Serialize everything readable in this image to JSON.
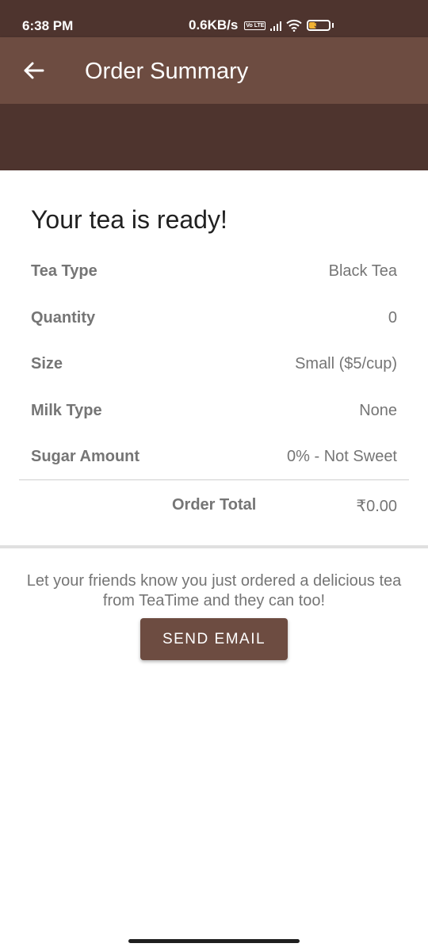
{
  "status_bar": {
    "time": "6:38 PM",
    "network_speed": "0.6KB/s",
    "volte_badge": "Vo LTE",
    "battery_level": "37",
    "battery_percent": 37
  },
  "app_bar": {
    "title": "Order Summary",
    "back_icon": "arrow-left-icon"
  },
  "summary": {
    "heading": "Your tea is ready!",
    "rows": [
      {
        "label": "Tea Type",
        "value": "Black Tea"
      },
      {
        "label": "Quantity",
        "value": "0"
      },
      {
        "label": "Size",
        "value": "Small ($5/cup)"
      },
      {
        "label": "Milk Type",
        "value": "None"
      },
      {
        "label": "Sugar Amount",
        "value": "0% - Not Sweet"
      }
    ],
    "total_label": "Order Total",
    "total_value": "₹0.00"
  },
  "share": {
    "message": "Let your friends know you just ordered a delicious tea from TeaTime and they can too!",
    "button_label": "SEND EMAIL"
  },
  "colors": {
    "primary": "#6d4c41",
    "primary_dark": "#4e342e",
    "text_secondary": "#757575",
    "battery": "#f2b233"
  }
}
